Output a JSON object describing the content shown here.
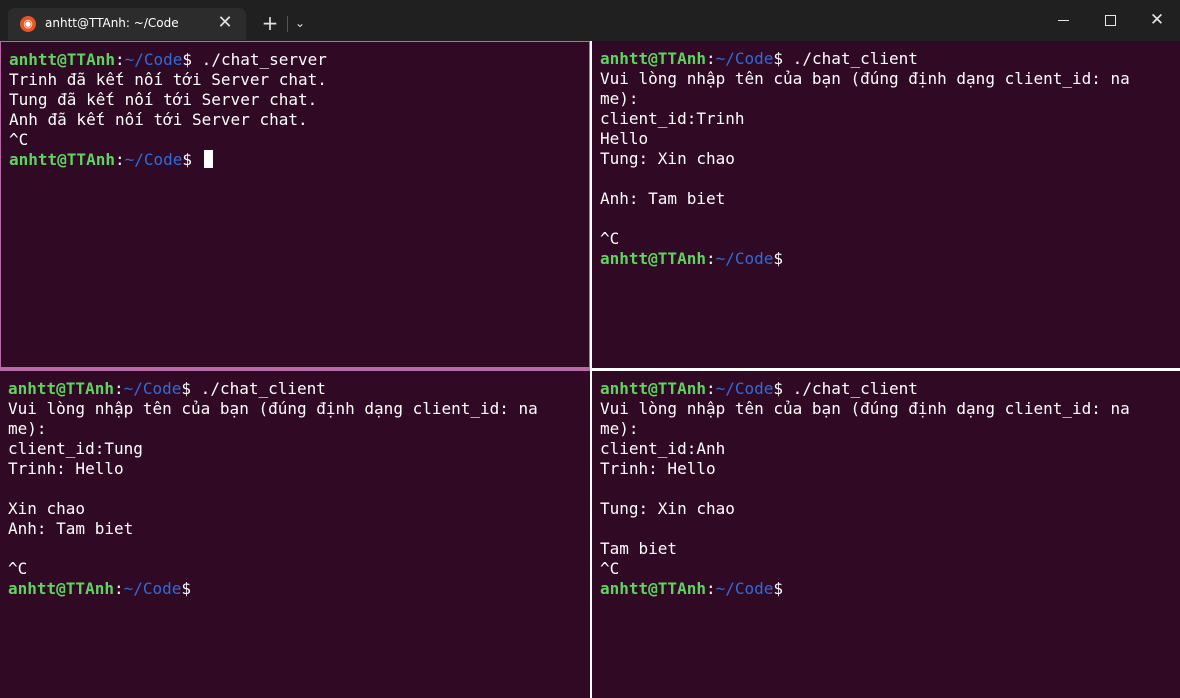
{
  "window": {
    "tab_title": "anhtt@TTAnh: ~/Code",
    "tab_icon": "ubuntu-icon",
    "close_tab_glyph": "✕",
    "new_tab_glyph": "+",
    "dropdown_glyph": "⌄",
    "close_glyph": "✕"
  },
  "prompt": {
    "user": "anhtt@TTAnh",
    "colon": ":",
    "path": "~/Code",
    "dollar": "$"
  },
  "panes": {
    "top_left": {
      "command": " ./chat_server",
      "lines": [
        "Trinh đã kết nối tới Server chat.",
        "Tung đã kết nối tới Server chat.",
        "Anh đã kết nối tới Server chat.",
        "^C"
      ],
      "final_cmd": " "
    },
    "top_right": {
      "command": " ./chat_client",
      "lines": [
        "Vui lòng nhập tên của bạn (đúng định dạng client_id: na",
        "me):",
        "client_id:Trinh",
        "Hello",
        "Tung: Xin chao",
        "",
        "Anh: Tam biet",
        "",
        "^C"
      ]
    },
    "bottom_left": {
      "command": " ./chat_client",
      "lines": [
        "Vui lòng nhập tên của bạn (đúng định dạng client_id: na",
        "me):",
        "client_id:Tung",
        "Trinh: Hello",
        "",
        "Xin chao",
        "Anh: Tam biet",
        "",
        "^C"
      ]
    },
    "bottom_right": {
      "command": " ./chat_client",
      "lines": [
        "Vui lòng nhập tên của bạn (đúng định dạng client_id: na",
        "me):",
        "client_id:Anh",
        "Trinh: Hello",
        "",
        "Tung: Xin chao",
        "",
        "Tam biet",
        "^C"
      ]
    }
  },
  "colors": {
    "terminal_bg": "#300a24",
    "prompt_user": "#5ed35e",
    "prompt_path": "#2f6bd8",
    "active_border": "#b86aa6"
  }
}
